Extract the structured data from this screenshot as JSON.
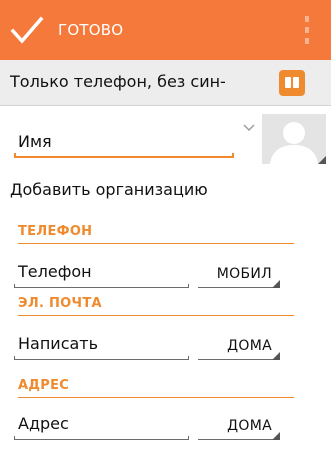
{
  "toolbar": {
    "done_label": "ГОТОВО",
    "icons": {
      "done": "check-icon",
      "overflow": "overflow-menu-icon"
    },
    "color": "#f5793a"
  },
  "account": {
    "label": "Только телефон, без син-",
    "icon": "contacts-book-icon"
  },
  "name": {
    "placeholder": "Имя",
    "expand_icon": "chevron-down-icon",
    "avatar_icon": "person-silhouette-icon"
  },
  "add_organization_label": "Добавить организацию",
  "sections": {
    "phone": {
      "header": "ТЕЛЕФОН",
      "field_placeholder": "Телефон",
      "type": "МОБИЛ"
    },
    "email": {
      "header": "ЭЛ. ПОЧТА",
      "field_placeholder": "Написать",
      "type": "ДОМА"
    },
    "address": {
      "header": "АДРЕС",
      "field_placeholder": "Адрес",
      "type": "ДОМА"
    }
  },
  "accent_color": "#f08a2e"
}
